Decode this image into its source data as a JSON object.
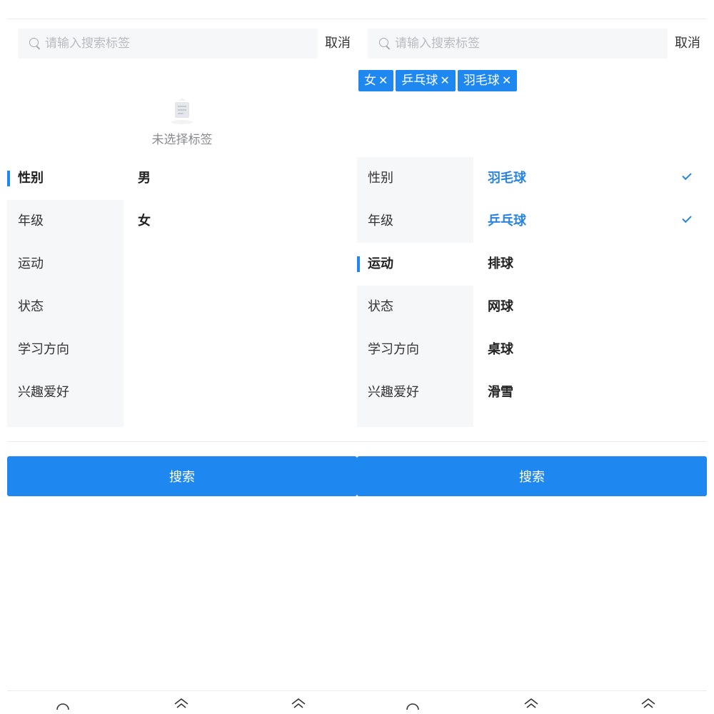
{
  "left": {
    "search": {
      "placeholder": "请输入搜索标签",
      "value": "",
      "cancel_label": "取消"
    },
    "empty_text": "未选择标签",
    "categories": [
      "性别",
      "年级",
      "运动",
      "状态",
      "学习方向",
      "兴趣爱好"
    ],
    "active_category": 0,
    "options": [
      {
        "label": "男",
        "selected": false
      },
      {
        "label": "女",
        "selected": false
      }
    ],
    "search_button_label": "搜索"
  },
  "right": {
    "search": {
      "placeholder": "请输入搜索标签",
      "value": "",
      "cancel_label": "取消"
    },
    "selected_tags": [
      {
        "label": "女",
        "close": "✕"
      },
      {
        "label": "乒乓球",
        "close": "✕"
      },
      {
        "label": "羽毛球",
        "close": "✕"
      }
    ],
    "categories": [
      "性别",
      "年级",
      "运动",
      "状态",
      "学习方向",
      "兴趣爱好"
    ],
    "active_category": 2,
    "options": [
      {
        "label": "羽毛球",
        "selected": true
      },
      {
        "label": "乒乓球",
        "selected": true
      },
      {
        "label": "排球",
        "selected": false
      },
      {
        "label": "网球",
        "selected": false
      },
      {
        "label": "桌球",
        "selected": false
      },
      {
        "label": "滑雪",
        "selected": false
      }
    ],
    "search_button_label": "搜索"
  },
  "tabbar_icons": [
    "circle-tab-icon",
    "chevron-up-tab-icon",
    "chevron-up-tab-icon",
    "circle-tab-icon",
    "chevron-up-tab-icon",
    "chevron-up-tab-icon"
  ],
  "colors": {
    "accent": "#1e88f0",
    "selected_text": "#2a84dc",
    "sidebar_bg": "#f6f7f9"
  }
}
